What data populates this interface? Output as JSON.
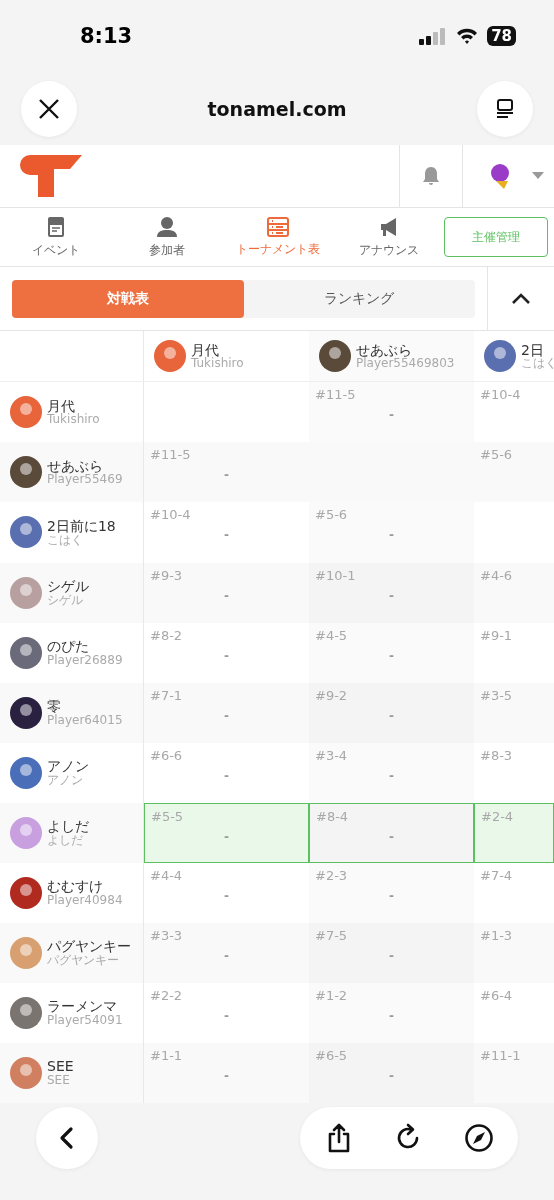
{
  "status_bar": {
    "time": "8:13",
    "battery": "78"
  },
  "browser": {
    "url": "tonamel.com"
  },
  "nav": {
    "tabs": [
      {
        "label": "イベント",
        "kind": "event",
        "selected": false
      },
      {
        "label": "参加者",
        "kind": "person",
        "selected": false
      },
      {
        "label": "トーナメント表",
        "kind": "bracket",
        "selected": true
      },
      {
        "label": "アナウンス",
        "kind": "megaphone",
        "selected": false
      }
    ],
    "admin_button": "主催管理"
  },
  "view_tabs": [
    {
      "label": "対戦表",
      "selected": true
    },
    {
      "label": "ランキング",
      "selected": false
    }
  ],
  "columns": [
    {
      "name": "月代",
      "sub": "Tukishiro"
    },
    {
      "name": "せあぶら",
      "sub": "Player55469803"
    },
    {
      "name": "2日",
      "sub": "こはく"
    }
  ],
  "rows": [
    {
      "name": "月代",
      "sub": "Tukishiro",
      "highlighted": false,
      "cells": [
        {},
        {
          "match": "#11-5",
          "score": "-"
        },
        {
          "match": "#10-4"
        }
      ]
    },
    {
      "name": "せあぶら",
      "sub": "Player55469",
      "highlighted": false,
      "cells": [
        {
          "match": "#11-5",
          "score": "-"
        },
        {},
        {
          "match": "#5-6"
        }
      ]
    },
    {
      "name": "2日前に18",
      "sub": "こはく",
      "highlighted": false,
      "cells": [
        {
          "match": "#10-4",
          "score": "-"
        },
        {
          "match": "#5-6",
          "score": "-"
        },
        {}
      ]
    },
    {
      "name": "シゲル",
      "sub": "シゲル",
      "highlighted": false,
      "cells": [
        {
          "match": "#9-3",
          "score": "-"
        },
        {
          "match": "#10-1",
          "score": "-"
        },
        {
          "match": "#4-6"
        }
      ]
    },
    {
      "name": "のぴた",
      "sub": "Player26889",
      "highlighted": false,
      "cells": [
        {
          "match": "#8-2",
          "score": "-"
        },
        {
          "match": "#4-5",
          "score": "-"
        },
        {
          "match": "#9-1"
        }
      ]
    },
    {
      "name": "零",
      "sub": "Player64015",
      "highlighted": false,
      "cells": [
        {
          "match": "#7-1",
          "score": "-"
        },
        {
          "match": "#9-2",
          "score": "-"
        },
        {
          "match": "#3-5"
        }
      ]
    },
    {
      "name": "アノン",
      "sub": "アノン",
      "highlighted": false,
      "cells": [
        {
          "match": "#6-6",
          "score": "-"
        },
        {
          "match": "#3-4",
          "score": "-"
        },
        {
          "match": "#8-3"
        }
      ]
    },
    {
      "name": "よしだ",
      "sub": "よしだ",
      "highlighted": true,
      "cells": [
        {
          "match": "#5-5",
          "score": "-"
        },
        {
          "match": "#8-4",
          "score": "-"
        },
        {
          "match": "#2-4"
        }
      ]
    },
    {
      "name": "むむすけ",
      "sub": "Player40984",
      "highlighted": false,
      "cells": [
        {
          "match": "#4-4",
          "score": "-"
        },
        {
          "match": "#2-3",
          "score": "-"
        },
        {
          "match": "#7-4"
        }
      ]
    },
    {
      "name": "パグヤンキー",
      "sub": "パグヤンキー",
      "highlighted": false,
      "cells": [
        {
          "match": "#3-3",
          "score": "-"
        },
        {
          "match": "#7-5",
          "score": "-"
        },
        {
          "match": "#1-3"
        }
      ]
    },
    {
      "name": "ラーメンマ",
      "sub": "Player54091",
      "highlighted": false,
      "cells": [
        {
          "match": "#2-2",
          "score": "-"
        },
        {
          "match": "#1-2",
          "score": "-"
        },
        {
          "match": "#6-4"
        }
      ]
    },
    {
      "name": "SEE",
      "sub": "SEE",
      "highlighted": false,
      "cells": [
        {
          "match": "#1-1",
          "score": "-"
        },
        {
          "match": "#6-5",
          "score": "-"
        },
        {
          "match": "#11-1"
        }
      ]
    }
  ]
}
